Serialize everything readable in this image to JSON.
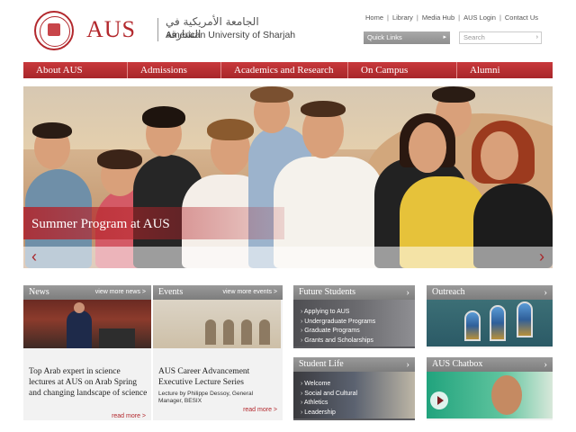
{
  "header": {
    "logo_text": "AUS",
    "logo_arabic": "الجامعة الأمريكية في الشارقة",
    "logo_english": "American University of Sharjah",
    "top_links": [
      "Home",
      "Library",
      "Media Hub",
      "AUS Login",
      "Contact Us"
    ],
    "quick_links_label": "Quick Links",
    "search_placeholder": "Search"
  },
  "nav": {
    "items": [
      "About AUS",
      "Admissions",
      "Academics and Research",
      "On Campus",
      "Alumni"
    ]
  },
  "hero": {
    "caption": "Summer Program at AUS"
  },
  "news": {
    "heading": "News",
    "more": "view more news >",
    "title": "Top Arab expert in science lectures at AUS on Arab Spring and changing landscape of science",
    "read_more": "read more >"
  },
  "events": {
    "heading": "Events",
    "more": "view more events >",
    "title": "AUS Career Advancement Executive Lecture Series",
    "subtitle": "Lecture by Philippe Dessoy, General Manager, BESIX",
    "read_more": "read more >"
  },
  "future_students": {
    "heading": "Future Students",
    "items": [
      "Applying to AUS",
      "Undergraduate Programs",
      "Graduate Programs",
      "Grants and Scholarships"
    ]
  },
  "student_life": {
    "heading": "Student Life",
    "items": [
      "Welcome",
      "Social and Cultural",
      "Athletics",
      "Leadership"
    ]
  },
  "outreach": {
    "heading": "Outreach"
  },
  "chatbox": {
    "heading": "AUS Chatbox"
  },
  "colors": {
    "brand_red": "#b3282d",
    "panel_grey": "#8a8a8a"
  }
}
